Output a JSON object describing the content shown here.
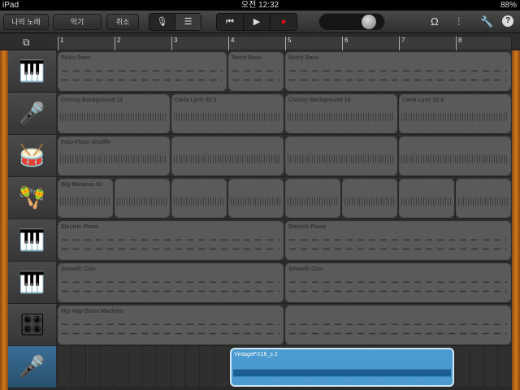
{
  "status": {
    "device": "iPad",
    "time": "오전 12:32",
    "battery": "88%"
  },
  "toolbar": {
    "my_songs": "나의 노래",
    "instruments": "악기",
    "undo": "취소",
    "view_icons": [
      "microphone-icon",
      "tracks-view-icon"
    ],
    "transport_icons": [
      "go-to-beginning-icon",
      "play-icon",
      "record-icon"
    ],
    "right_icons": [
      "loop-icon",
      "mixer-icon",
      "settings-wrench-icon",
      "help-icon"
    ],
    "record_color": "#e01010"
  },
  "ruler": {
    "bars": [
      "1",
      "2",
      "3",
      "4",
      "5",
      "6",
      "7",
      "8"
    ]
  },
  "tracks": [
    {
      "instrument": "synth-keyboard",
      "icon": "🎹",
      "regions": [
        {
          "name": "Retro Bass",
          "start": 1,
          "len": 3,
          "type": "midi"
        },
        {
          "name": "Retro Bass",
          "start": 4,
          "len": 1,
          "type": "midi"
        },
        {
          "name": "Retro Bass",
          "start": 5,
          "len": 4,
          "type": "midi"
        }
      ]
    },
    {
      "instrument": "microphone",
      "icon": "🎤",
      "regions": [
        {
          "name": "Christy Background 11",
          "start": 1,
          "len": 2,
          "type": "audio"
        },
        {
          "name": "Carla Lyric 02.3",
          "start": 3,
          "len": 2,
          "type": "audio"
        },
        {
          "name": "Christy Background 16",
          "start": 5,
          "len": 2,
          "type": "audio"
        },
        {
          "name": "Carla Lyric 02.6",
          "start": 7,
          "len": 2,
          "type": "audio"
        }
      ]
    },
    {
      "instrument": "drum-kit",
      "icon": "🥁",
      "regions": [
        {
          "name": "Four-Floor Shuffle",
          "start": 1,
          "len": 2,
          "type": "audio"
        },
        {
          "name": "",
          "start": 3,
          "len": 2,
          "type": "audio"
        },
        {
          "name": "",
          "start": 5,
          "len": 2,
          "type": "audio"
        },
        {
          "name": "",
          "start": 7,
          "len": 2,
          "type": "audio"
        }
      ]
    },
    {
      "instrument": "maracas",
      "icon": "🪇",
      "regions": [
        {
          "name": "Big Maracas 01",
          "start": 1,
          "len": 1,
          "type": "audio"
        },
        {
          "name": "",
          "start": 2,
          "len": 1,
          "type": "audio"
        },
        {
          "name": "",
          "start": 3,
          "len": 1,
          "type": "audio"
        },
        {
          "name": "",
          "start": 4,
          "len": 1,
          "type": "audio"
        },
        {
          "name": "",
          "start": 5,
          "len": 1,
          "type": "audio"
        },
        {
          "name": "",
          "start": 6,
          "len": 1,
          "type": "audio"
        },
        {
          "name": "",
          "start": 7,
          "len": 1,
          "type": "audio"
        },
        {
          "name": "",
          "start": 8,
          "len": 1,
          "type": "audio"
        }
      ]
    },
    {
      "instrument": "electric-piano",
      "icon": "🎹",
      "regions": [
        {
          "name": "Electric Piano",
          "start": 1,
          "len": 4,
          "type": "midi"
        },
        {
          "name": "Electric Piano",
          "start": 5,
          "len": 4,
          "type": "midi"
        }
      ]
    },
    {
      "instrument": "clavinet",
      "icon": "🎹",
      "regions": [
        {
          "name": "Smooth Clav",
          "start": 1,
          "len": 4,
          "type": "midi"
        },
        {
          "name": "Smooth Clav",
          "start": 5,
          "len": 4,
          "type": "midi"
        }
      ]
    },
    {
      "instrument": "drum-machine",
      "icon": "🎛",
      "regions": [
        {
          "name": "Hip Hop Drum Machine",
          "start": 1,
          "len": 4,
          "type": "midi"
        },
        {
          "name": "",
          "start": 5,
          "len": 4,
          "type": "midi"
        }
      ]
    },
    {
      "instrument": "microphone",
      "icon": "🎤",
      "selected": true,
      "regions": [
        {
          "name": "VintageFX16_s 2",
          "start": 4.03,
          "len": 3.97,
          "type": "blue"
        }
      ]
    }
  ]
}
